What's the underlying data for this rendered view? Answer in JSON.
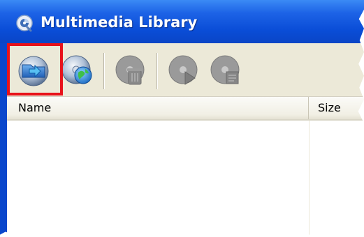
{
  "window": {
    "title": "Multimedia Library",
    "title_icon": "app-logo-icon",
    "titlebar_color": "#0a4dd7"
  },
  "toolbar": {
    "buttons": [
      {
        "icon": "import-disc-icon",
        "enabled": true,
        "highlighted": true
      },
      {
        "icon": "online-disc-icon",
        "enabled": true,
        "highlighted": false
      },
      {
        "icon": "delete-disc-icon",
        "enabled": false,
        "highlighted": false
      },
      {
        "icon": "play-disc-icon",
        "enabled": false,
        "highlighted": false
      },
      {
        "icon": "properties-disc-icon",
        "enabled": false,
        "highlighted": false
      }
    ],
    "highlight_color": "#e8121a"
  },
  "list": {
    "columns": [
      "Name",
      "Size"
    ],
    "rows": []
  }
}
